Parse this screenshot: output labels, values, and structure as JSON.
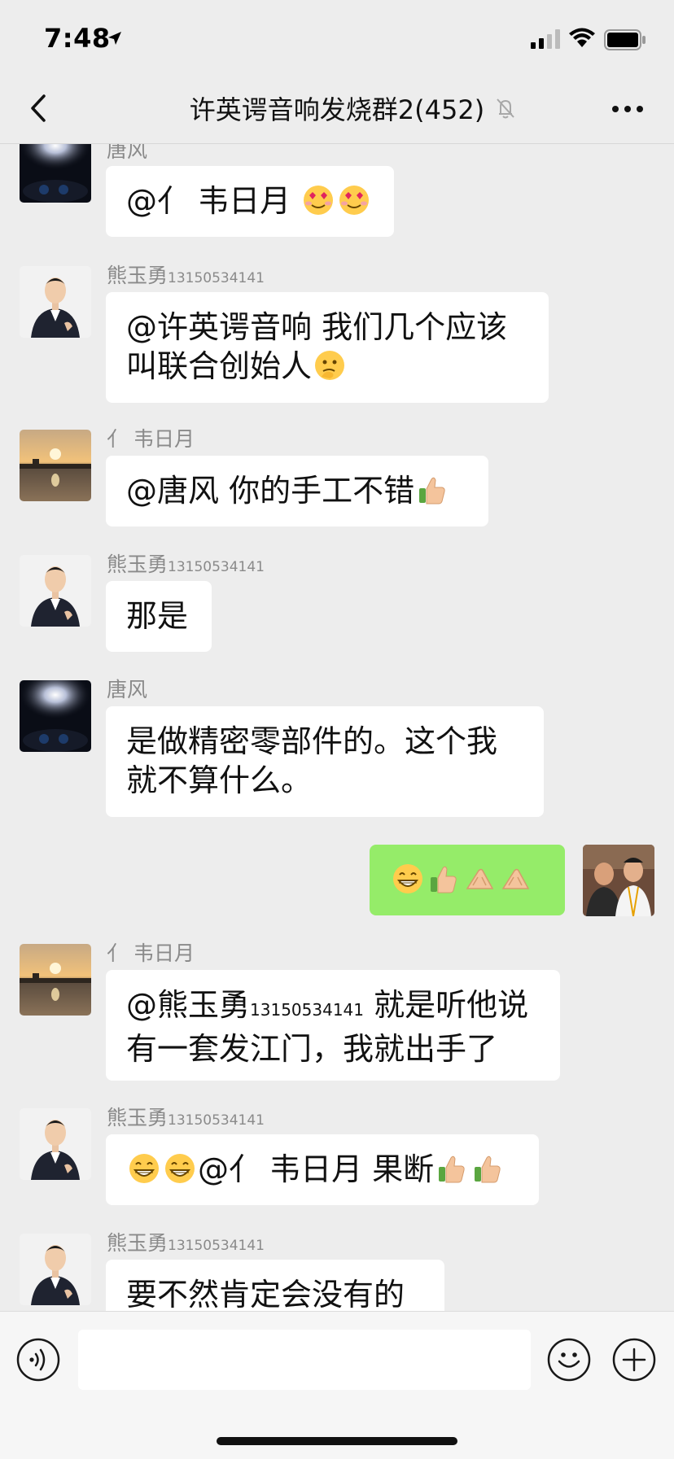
{
  "status_bar": {
    "time": "7:48"
  },
  "nav": {
    "title": "许英谔音响发烧群2(452)"
  },
  "messages": [
    {
      "sender": "唐风",
      "sender_phone": "",
      "text": "@亻 韦日月 "
    },
    {
      "sender": "熊玉勇",
      "sender_phone": "13150534141",
      "line1": "@许英谔音响 我们几个应该",
      "line2": "叫联合创始人"
    },
    {
      "sender": "亻 韦日月",
      "sender_phone": "",
      "text": "@唐风 你的手工不错"
    },
    {
      "sender": "熊玉勇",
      "sender_phone": "13150534141",
      "text": "那是"
    },
    {
      "sender": "唐风",
      "sender_phone": "",
      "line1": "是做精密零部件的。这个我",
      "line2": "就不算什么。"
    },
    {
      "sender": "",
      "sender_phone": "",
      "text": ""
    },
    {
      "sender": "亻 韦日月",
      "sender_phone": "",
      "line1_a": "@熊玉勇",
      "line1_phone": "13150534141",
      "line1_b": " 就是听他说",
      "line2": "有一套发江门，我就出手了"
    },
    {
      "sender": "熊玉勇",
      "sender_phone": "13150534141",
      "text_a": "@亻 韦日月 果断"
    },
    {
      "sender": "熊玉勇",
      "sender_phone": "13150534141",
      "text": "要不然肯定会没有的"
    }
  ],
  "icons": {
    "back": "chevron-left-icon",
    "mute": "bell-slash-icon",
    "more": "ellipsis-icon",
    "voice": "voice-icon",
    "emoji": "smiley-icon",
    "plus": "plus-circle-icon"
  },
  "colors": {
    "background": "#ededed",
    "bubble_incoming": "#ffffff",
    "bubble_outgoing": "#95ec69",
    "sender_name": "#8a8a8a"
  }
}
